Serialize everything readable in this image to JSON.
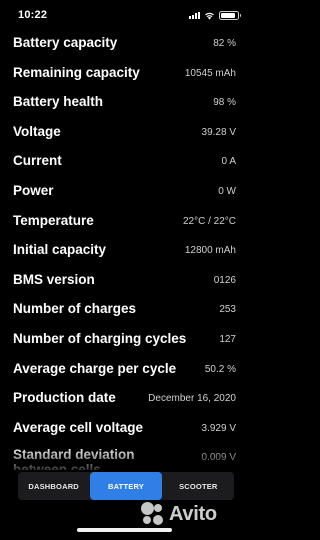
{
  "status_bar": {
    "time": "10:22",
    "battery_level": 0.9
  },
  "rows": [
    {
      "label": "Battery capacity",
      "value": "82 %"
    },
    {
      "label": "Remaining capacity",
      "value": "10545 mAh"
    },
    {
      "label": "Battery health",
      "value": "98 %"
    },
    {
      "label": "Voltage",
      "value": "39.28 V"
    },
    {
      "label": "Current",
      "value": "0 A"
    },
    {
      "label": "Power",
      "value": "0 W"
    },
    {
      "label": "Temperature",
      "value": "22°C / 22°C"
    },
    {
      "label": "Initial capacity",
      "value": "12800 mAh"
    },
    {
      "label": "BMS version",
      "value": "0126"
    },
    {
      "label": "Number of charges",
      "value": "253"
    },
    {
      "label": "Number of charging cycles",
      "value": "127"
    },
    {
      "label": "Average charge per cycle",
      "value": "50.2 %"
    },
    {
      "label": "Production date",
      "value": "December 16, 2020"
    },
    {
      "label": "Average cell voltage",
      "value": "3.929 V"
    },
    {
      "label": "Standard deviation between cells",
      "value": "0.009 V"
    }
  ],
  "tabs": [
    {
      "label": "DASHBOARD",
      "active": false
    },
    {
      "label": "BATTERY",
      "active": true
    },
    {
      "label": "SCOOTER",
      "active": false
    }
  ],
  "watermark": {
    "text": "Avito"
  },
  "colors": {
    "background": "#000000",
    "tab_active": "#2f7fe6",
    "tab_bar": "#1c1c1e",
    "label": "#ffffff",
    "value": "#d0d0d0"
  }
}
